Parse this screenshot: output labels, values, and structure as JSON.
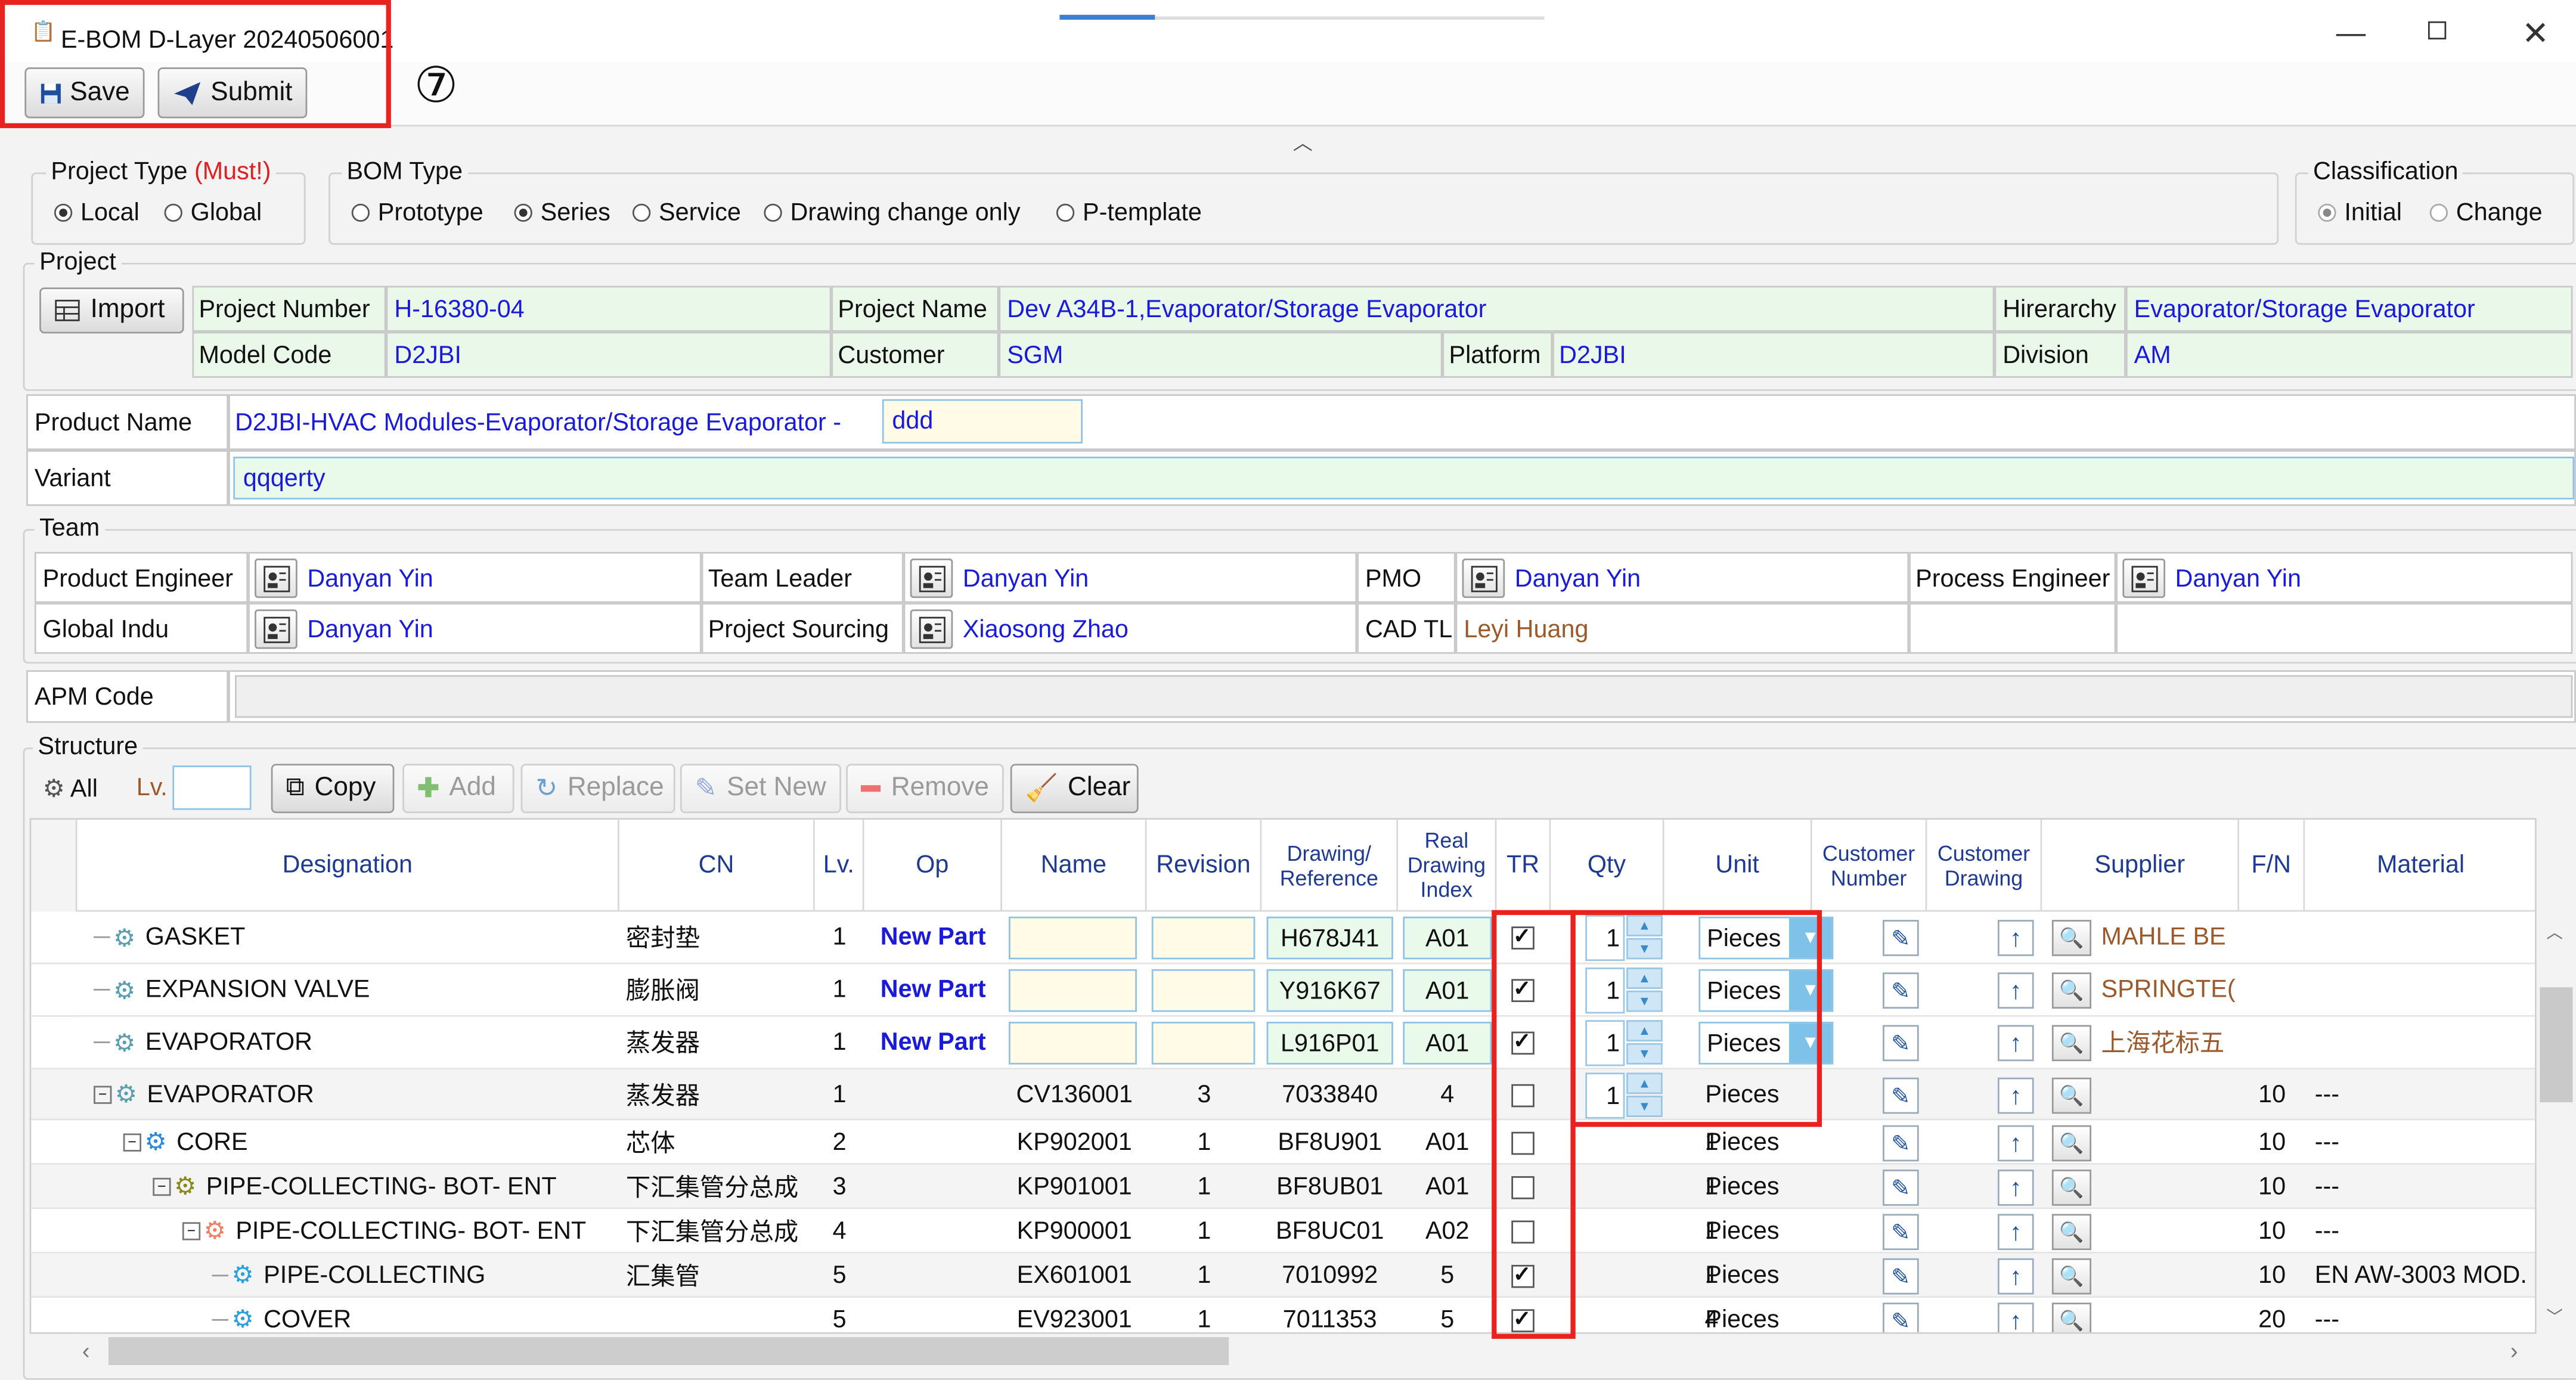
{
  "window": {
    "title": "E-BOM D-Layer 20240506001",
    "badge": "⑦"
  },
  "toolbar": {
    "save_label": "Save",
    "submit_label": "Submit"
  },
  "project_type": {
    "label": "Project Type",
    "must": "(Must!)",
    "options": [
      "Local",
      "Global"
    ],
    "selected": "Local"
  },
  "bom_type": {
    "label": "BOM Type",
    "options": [
      "Prototype",
      "Series",
      "Service",
      "Drawing change only",
      "P-template"
    ],
    "selected": "Series"
  },
  "classification": {
    "label": "Classification",
    "options": [
      "Initial",
      "Change"
    ],
    "selected": "Initial"
  },
  "project": {
    "label": "Project",
    "import_label": "Import",
    "fields": {
      "project_number_label": "Project Number",
      "project_number": "H-16380-04",
      "project_name_label": "Project Name",
      "project_name": "Dev A34B-1,Evaporator/Storage Evaporator",
      "hierarchy_label": "Hirerarchy",
      "hierarchy": "Evaporator/Storage Evaporator",
      "model_code_label": "Model Code",
      "model_code": "D2JBI",
      "customer_label": "Customer",
      "customer": "SGM",
      "platform_label": "Platform",
      "platform": "D2JBI",
      "division_label": "Division",
      "division": "AM"
    }
  },
  "product": {
    "name_label": "Product Name",
    "name_prefix": "D2JBI-HVAC Modules-Evaporator/Storage Evaporator -",
    "name_suffix": "ddd",
    "variant_label": "Variant",
    "variant": "qqqerty"
  },
  "team": {
    "label": "Team",
    "product_engineer_label": "Product Engineer",
    "product_engineer": "Danyan Yin",
    "team_leader_label": "Team Leader",
    "team_leader": "Danyan Yin",
    "pmo_label": "PMO",
    "pmo": "Danyan Yin",
    "process_engineer_label": "Process Engineer",
    "process_engineer": "Danyan Yin",
    "global_indu_label": "Global Indu",
    "global_indu": "Danyan Yin",
    "project_sourcing_label": "Project Sourcing",
    "project_sourcing": "Xiaosong Zhao",
    "cad_tl_label": "CAD TL",
    "cad_tl": "Leyi Huang"
  },
  "apm": {
    "label": "APM Code",
    "value": ""
  },
  "structure": {
    "label": "Structure",
    "all_label": "All",
    "lv_label": "Lv.",
    "copy": "Copy",
    "add": "Add",
    "replace": "Replace",
    "set_new": "Set New",
    "remove": "Remove",
    "clear": "Clear"
  },
  "columns": {
    "designation": "Designation",
    "cn": "CN",
    "lv": "Lv.",
    "op": "Op",
    "name": "Name",
    "revision": "Revision",
    "drawing": "Drawing/ Reference",
    "real_index": "Real Drawing Index",
    "tr": "TR",
    "qty": "Qty",
    "unit": "Unit",
    "cust_num": "Customer Number",
    "cust_draw": "Customer Drawing",
    "supplier": "Supplier",
    "fn": "F/N",
    "material": "Material"
  },
  "rows": [
    {
      "designation": "GASKET",
      "cn": "密封垫",
      "lv": "1",
      "op": "New Part",
      "name": "",
      "revision": "",
      "drawing": "H678J41",
      "index": "A01",
      "tr": true,
      "qty": "1",
      "unit": "Pieces",
      "supplier": "MAHLE BE",
      "fn": "",
      "material": ""
    },
    {
      "designation": "EXPANSION VALVE",
      "cn": "膨胀阀",
      "lv": "1",
      "op": "New Part",
      "name": "",
      "revision": "",
      "drawing": "Y916K67",
      "index": "A01",
      "tr": true,
      "qty": "1",
      "unit": "Pieces",
      "supplier": "SPRINGTE(",
      "fn": "",
      "material": ""
    },
    {
      "designation": "EVAPORATOR",
      "cn": "蒸发器",
      "lv": "1",
      "op": "New Part",
      "name": "",
      "revision": "",
      "drawing": "L916P01",
      "index": "A01",
      "tr": true,
      "qty": "1",
      "unit": "Pieces",
      "supplier": "上海花标五",
      "fn": "",
      "material": ""
    },
    {
      "designation": "EVAPORATOR",
      "cn": "蒸发器",
      "lv": "1",
      "op": "",
      "name": "CV136001",
      "revision": "3",
      "drawing": "7033840",
      "index": "4",
      "tr": false,
      "qty": "1",
      "unit": "Pieces",
      "supplier": "",
      "fn": "10",
      "material": "---"
    },
    {
      "designation": "CORE",
      "cn": "芯体",
      "lv": "2",
      "op": "",
      "name": "KP902001",
      "revision": "1",
      "drawing": "BF8U901",
      "index": "A01",
      "tr": false,
      "qty": "1",
      "unit": "Pieces",
      "supplier": "",
      "fn": "10",
      "material": "---"
    },
    {
      "designation": "PIPE-COLLECTING- BOT- ENT",
      "cn": "下汇集管分总成",
      "lv": "3",
      "op": "",
      "name": "KP901001",
      "revision": "1",
      "drawing": "BF8UB01",
      "index": "A01",
      "tr": false,
      "qty": "1",
      "unit": "Pieces",
      "supplier": "",
      "fn": "10",
      "material": "---"
    },
    {
      "designation": "PIPE-COLLECTING- BOT- ENT",
      "cn": "下汇集管分总成",
      "lv": "4",
      "op": "",
      "name": "KP900001",
      "revision": "1",
      "drawing": "BF8UC01",
      "index": "A02",
      "tr": false,
      "qty": "1",
      "unit": "Pieces",
      "supplier": "",
      "fn": "10",
      "material": "---"
    },
    {
      "designation": "PIPE-COLLECTING",
      "cn": "汇集管",
      "lv": "5",
      "op": "",
      "name": "EX601001",
      "revision": "1",
      "drawing": "7010992",
      "index": "5",
      "tr": true,
      "qty": "1",
      "unit": "Pieces",
      "supplier": "",
      "fn": "10",
      "material": "EN AW-3003 MOD."
    },
    {
      "designation": "COVER",
      "cn": "",
      "lv": "5",
      "op": "",
      "name": "EV923001",
      "revision": "1",
      "drawing": "7011353",
      "index": "5",
      "tr": true,
      "qty": "4",
      "unit": "Pieces",
      "supplier": "",
      "fn": "20",
      "material": "---"
    }
  ]
}
